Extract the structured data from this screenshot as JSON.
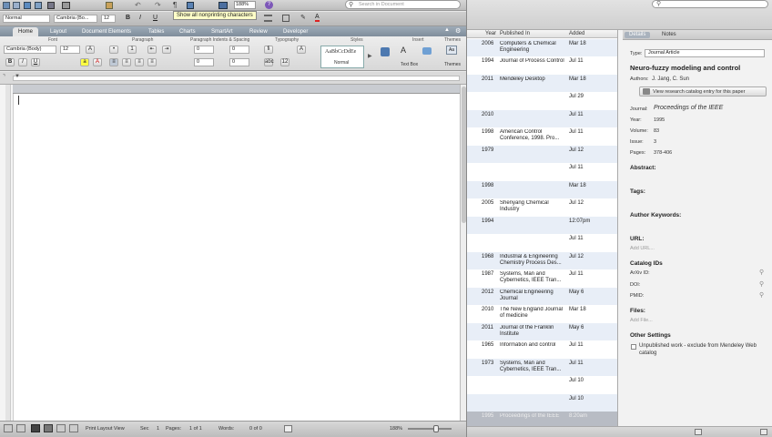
{
  "word": {
    "toolbar": {
      "zoom": "188%",
      "search_placeholder": "Search in Document",
      "tooltip": "Show all nonprinting characters",
      "style_select": "Normal",
      "font_name": "Cambria (Bo...",
      "font_size": "12"
    },
    "ribbon_tabs": [
      "Home",
      "Layout",
      "Document Elements",
      "Tables",
      "Charts",
      "SmartArt",
      "Review",
      "Developer"
    ],
    "ribbon_groups": [
      "Font",
      "Paragraph",
      "Paragraph Indents & Spacing",
      "Typography",
      "Styles",
      "Insert",
      "Themes"
    ],
    "ribbon": {
      "font_name": "Cambria (Body)",
      "font_size": "12",
      "indent_left": "0",
      "indent_right": "0",
      "spacing_before": "0",
      "spacing_after": "0",
      "style_preview": "AaBbCcDdEe",
      "style_name": "Normal",
      "text_box": "Text Box",
      "themes": "Themes"
    },
    "status": {
      "view": "Print Layout View",
      "sec_label": "Sec",
      "sec": "1",
      "pages_label": "Pages:",
      "pages": "1 of 1",
      "words_label": "Words:",
      "words": "0 of 0",
      "zoom": "188%"
    }
  },
  "mendeley": {
    "columns": [
      "Year",
      "Published In",
      "Added"
    ],
    "rows": [
      {
        "year": "2006",
        "published": "Computers & Chemical Engineering",
        "added": "Mar 18"
      },
      {
        "year": "1994",
        "published": "Journal of Process Control",
        "added": "Jul 11"
      },
      {
        "year": "2011",
        "published": "Mendeley Desktop",
        "added": "Mar 18"
      },
      {
        "year": "",
        "published": "",
        "added": "Jul 29"
      },
      {
        "year": "2010",
        "published": "",
        "added": "Jul 11"
      },
      {
        "year": "1998",
        "published": "American Control Conference, 1998. Pro...",
        "added": "Jul 11"
      },
      {
        "year": "1979",
        "published": "",
        "added": "Jul 12"
      },
      {
        "year": "",
        "published": "",
        "added": "Jul 11"
      },
      {
        "year": "1998",
        "published": "",
        "added": "Mar 18"
      },
      {
        "year": "2005",
        "published": "Shenyang Chemical Industry",
        "added": "Jul 12"
      },
      {
        "year": "1994",
        "published": "",
        "added": "12:07pm"
      },
      {
        "year": "",
        "published": "",
        "added": "Jul 11"
      },
      {
        "year": "1968",
        "published": "Industrial & Engineering Chemistry Process Des...",
        "added": "Jul 12"
      },
      {
        "year": "1987",
        "published": "Systems, Man and Cybernetics, IEEE Tran...",
        "added": "Jul 11"
      },
      {
        "year": "2012",
        "published": "Chemical Engineering Journal",
        "added": "May 6"
      },
      {
        "year": "2010",
        "published": "The New England Journal of medicine",
        "added": "Mar 18"
      },
      {
        "year": "2011",
        "published": "Journal of the Franklin Institute",
        "added": "May 6"
      },
      {
        "year": "1965",
        "published": "Information and control",
        "added": "Jul 11"
      },
      {
        "year": "1973",
        "published": "Systems, Man and Cybernetics, IEEE Tran...",
        "added": "Jul 11"
      },
      {
        "year": "",
        "published": "",
        "added": "Jul 10"
      },
      {
        "year": "",
        "published": "",
        "added": "Jul 10"
      },
      {
        "year": "1995",
        "published": "Proceedings of the IEEE",
        "added": "8:20am"
      }
    ],
    "details": {
      "tabs": [
        "Details",
        "Notes"
      ],
      "type_label": "Type:",
      "type_value": "Journal Article",
      "title": "Neuro-fuzzy modeling and control",
      "authors_label": "Authors:",
      "authors": "J. Jang, C. Sun",
      "catalog_link": "View research catalog entry for this paper",
      "journal_label": "Journal:",
      "journal": "Proceedings of the IEEE",
      "year_label": "Year:",
      "year": "1995",
      "volume_label": "Volume:",
      "volume": "83",
      "issue_label": "Issue:",
      "issue": "3",
      "pages_label": "Pages:",
      "pages": "378-406",
      "abstract": "Abstract:",
      "tags": "Tags:",
      "keywords": "Author Keywords:",
      "url": "URL:",
      "add_url": "Add URL...",
      "catalog_ids": "Catalog IDs",
      "arxiv": "ArXiv ID:",
      "doi": "DOI:",
      "pmid": "PMID:",
      "files": "Files:",
      "add_file": "Add File...",
      "other": "Other Settings",
      "unpublished": "Unpublished work - exclude from Mendeley Web catalog"
    }
  }
}
